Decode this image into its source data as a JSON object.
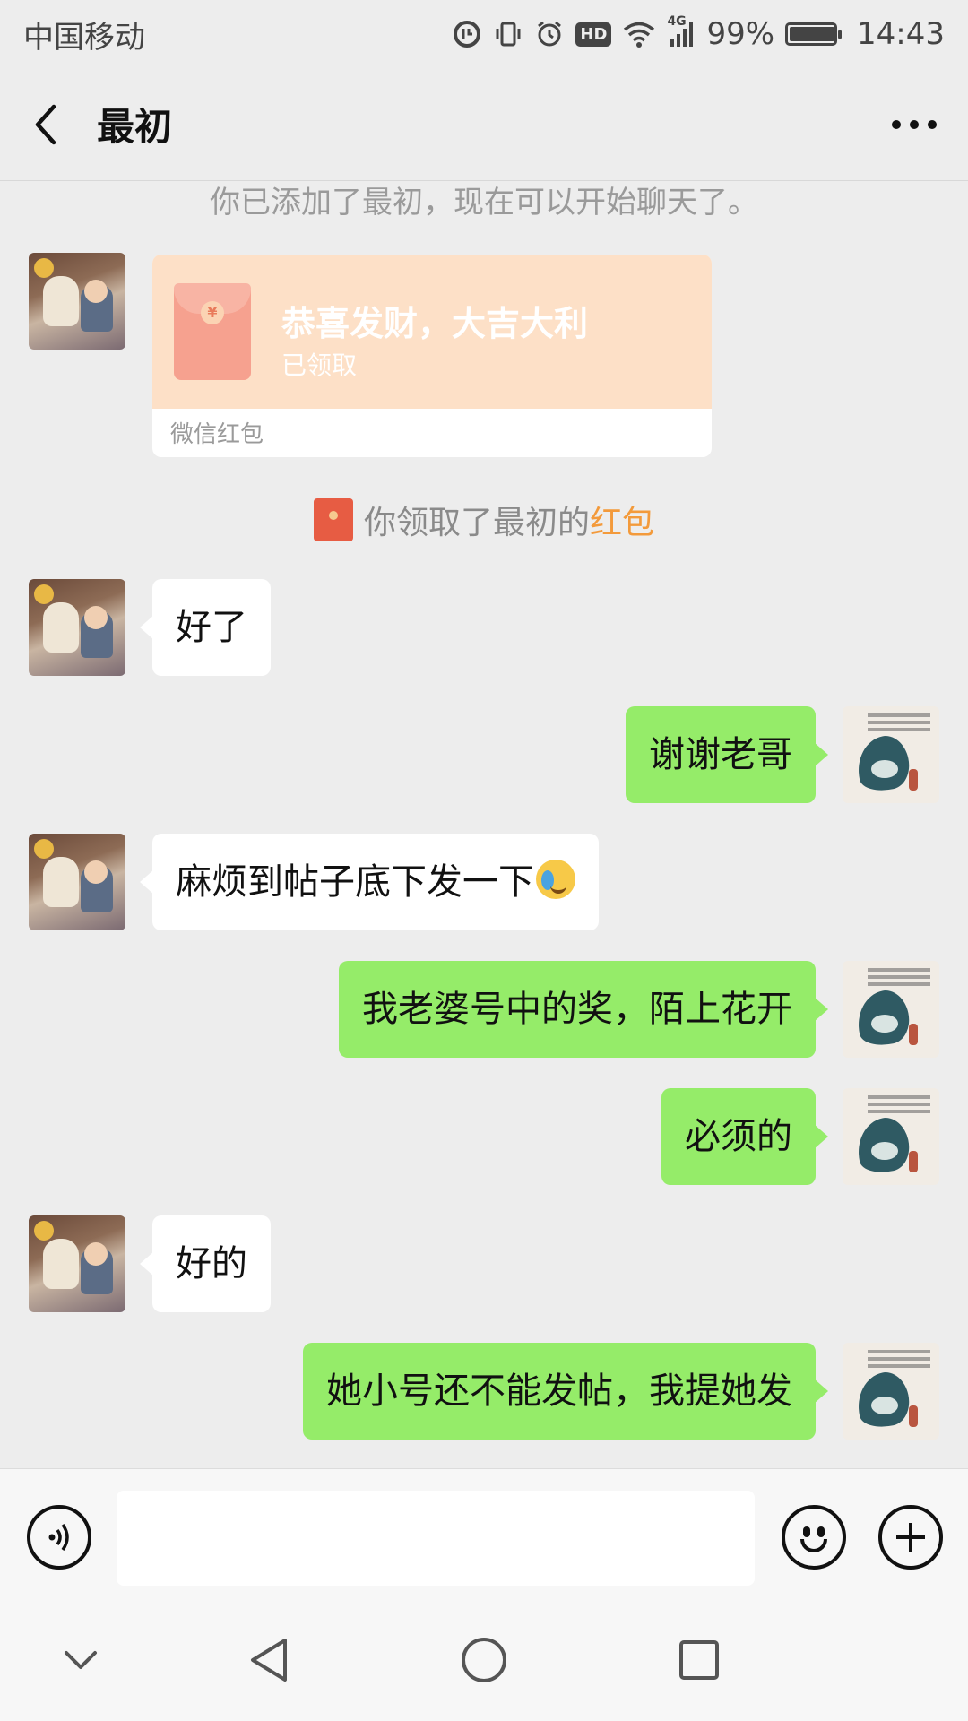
{
  "status_bar": {
    "carrier": "中国移动",
    "network": "4G",
    "hd": "HD",
    "battery_percent": "99%",
    "battery_level": 0.99,
    "time": "14:43"
  },
  "header": {
    "title": "最初"
  },
  "messages": {
    "added_note": "你已添加了最初，现在可以开始聊天了。",
    "red_packet": {
      "greeting": "恭喜发财，大吉大利",
      "status": "已领取",
      "label": "微信红包",
      "coin_symbol": "¥"
    },
    "claim_note": {
      "text": "你领取了最初的",
      "link": "红包"
    },
    "m1": "好了",
    "m2": "谢谢老哥",
    "m3": "麻烦到帖子底下发一下",
    "m4": "我老婆号中的奖，陌上花开",
    "m5": "必须的",
    "m6": "好的",
    "m7": "她小号还不能发帖，我提她发"
  },
  "input_bar": {
    "value": ""
  },
  "colors": {
    "background": "#ededed",
    "outgoing_bubble": "#95ec69",
    "incoming_bubble": "#ffffff",
    "red_packet": "#fde0c7",
    "link": "#f39a3b"
  }
}
